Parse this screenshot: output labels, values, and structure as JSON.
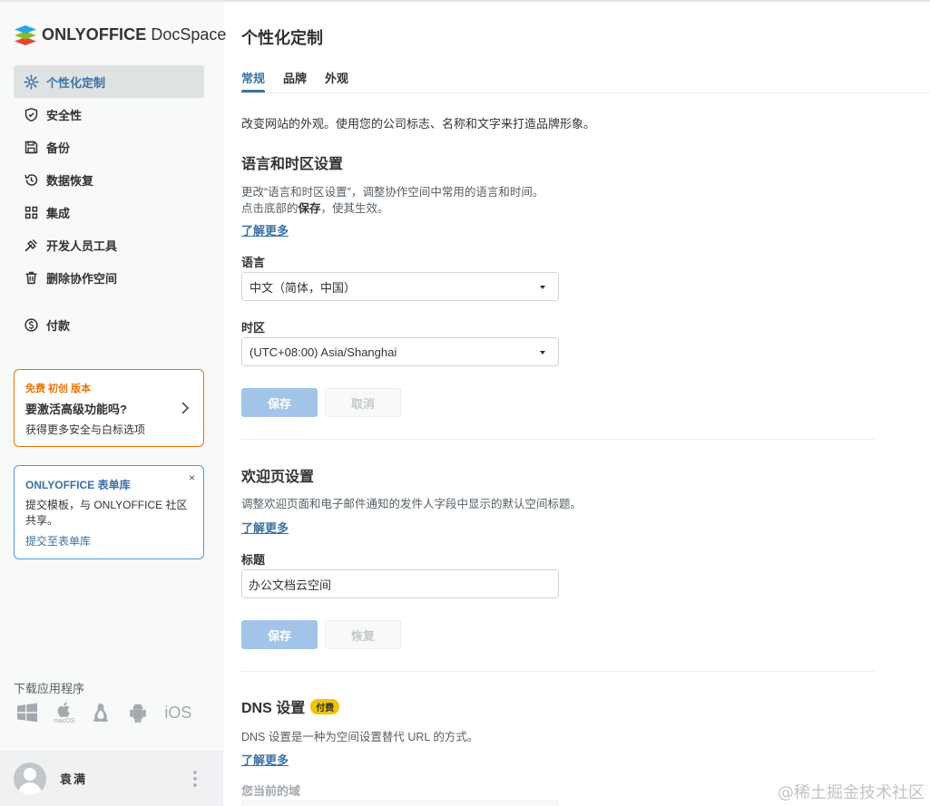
{
  "app": {
    "brand_bold": "ONLYOFFICE",
    "brand_regular": "DocSpace"
  },
  "sidebar": {
    "items": [
      {
        "label": "个性化定制",
        "icon": "gear-icon",
        "active": true
      },
      {
        "label": "安全性",
        "icon": "shield-icon"
      },
      {
        "label": "备份",
        "icon": "floppy-icon"
      },
      {
        "label": "数据恢复",
        "icon": "history-icon"
      },
      {
        "label": "集成",
        "icon": "grid-icon"
      },
      {
        "label": "开发人员工具",
        "icon": "developer-tools-icon"
      },
      {
        "label": "删除协作空间",
        "icon": "trash-icon"
      },
      {
        "label": "付款",
        "icon": "dollar-icon"
      }
    ],
    "promo": {
      "badge": "免费 初创 版本",
      "title": "要激活高级功能吗?",
      "desc": "获得更多安全与白标选项"
    },
    "forms_card": {
      "title": "ONLYOFFICE 表单库",
      "desc": "提交模板，与 ONLYOFFICE 社区共享。",
      "link": "提交至表单库",
      "close": "×"
    },
    "download": {
      "label": "下载应用程序",
      "mac_label": "macOS",
      "ios_label": "iOS"
    },
    "profile": {
      "name": "袁满"
    }
  },
  "main": {
    "title": "个性化定制",
    "tabs": [
      {
        "label": "常规",
        "active": true
      },
      {
        "label": "品牌"
      },
      {
        "label": "外观"
      }
    ],
    "intro": "改变网站的外观。使用您的公司标志、名称和文字来打造品牌形象。",
    "language_section": {
      "title": "语言和时区设置",
      "desc_line1": "更改“语言和时区设置”，调整协作空间中常用的语言和时间。",
      "desc_line2_pre": "点击底部的",
      "desc_line2_bold": "保存",
      "desc_line2_post": "，使其生效。",
      "learn_more": "了解更多",
      "language_label": "语言",
      "language_value": "中文（简体，中国）",
      "timezone_label": "时区",
      "timezone_value": "(UTC+08:00) Asia/Shanghai",
      "save": "保存",
      "cancel": "取消"
    },
    "welcome_section": {
      "title": "欢迎页设置",
      "desc": "调整欢迎页面和电子邮件通知的发件人字段中显示的默认空间标题。",
      "learn_more": "了解更多",
      "title_label": "标题",
      "title_value": "办公文档云空间",
      "save": "保存",
      "restore": "恢复"
    },
    "dns_section": {
      "title": "DNS 设置",
      "badge": "付费",
      "desc": "DNS 设置是一种为空间设置替代 URL 的方式。",
      "learn_more": "了解更多",
      "domain_label": "您当前的域"
    }
  },
  "watermark": "@稀土掘金技术社区",
  "colors": {
    "accent": "#3b72a7",
    "promo_border": "#ed7309",
    "forms_border": "#5299e0",
    "primary_button_disabled": "#a2c4e8",
    "paid_badge": "#edc409"
  }
}
